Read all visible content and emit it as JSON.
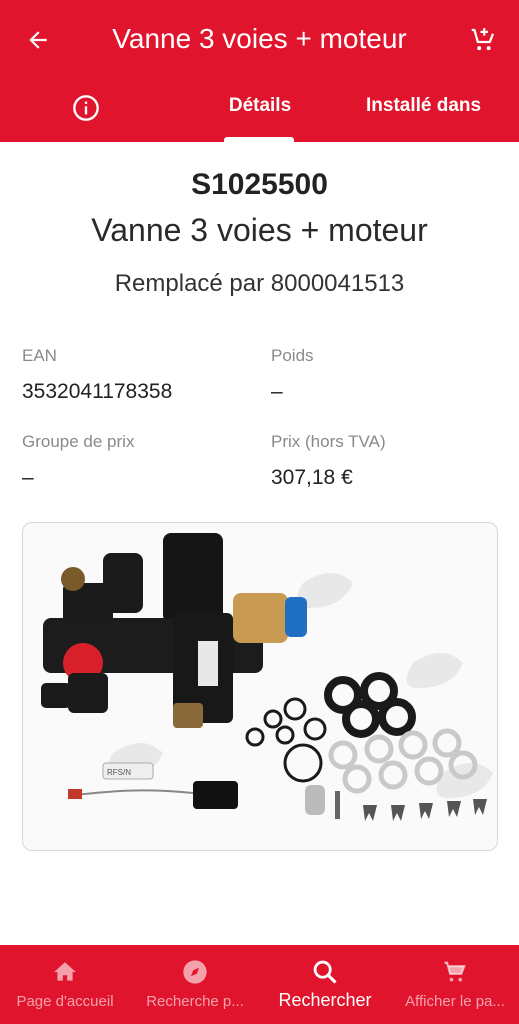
{
  "colors": {
    "brand": "#e1142d",
    "on_brand": "#ffffff"
  },
  "appbar": {
    "title": "Vanne 3 voies + moteur",
    "back_icon": "arrow-left-icon",
    "cart_icon": "cart-add-icon"
  },
  "tabs": {
    "info_icon": "info-icon",
    "items": [
      {
        "label": "Détails",
        "active": true
      },
      {
        "label": "Installé dans",
        "active": false
      }
    ]
  },
  "product": {
    "reference": "S1025500",
    "name": "Vanne 3 voies + moteur",
    "replaced_by": "Remplacé par 8000041513",
    "attributes": [
      {
        "label": "EAN",
        "value": "3532041178358"
      },
      {
        "label": "Poids",
        "value": "–"
      },
      {
        "label": "Groupe de prix",
        "value": "–"
      },
      {
        "label": "Prix (hors TVA)",
        "value": "307,18 €"
      }
    ],
    "image_label": "RFS/N"
  },
  "bottom_nav": [
    {
      "label": "Page d'accueil",
      "icon": "home-icon",
      "active": false
    },
    {
      "label": "Recherche p...",
      "icon": "compass-icon",
      "active": false
    },
    {
      "label": "Rechercher",
      "icon": "search-icon",
      "active": true
    },
    {
      "label": "Afficher le pa...",
      "icon": "cart-icon",
      "active": false
    }
  ]
}
